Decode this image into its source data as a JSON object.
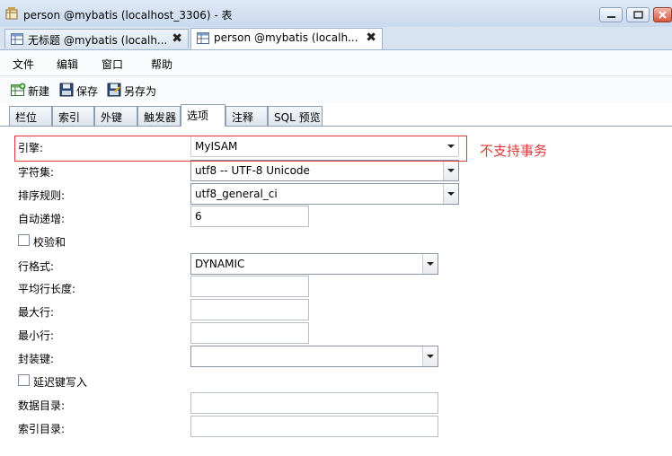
{
  "window": {
    "title": "person @mybatis (localhost_3306) - 表",
    "icon": "table-design-icon"
  },
  "doc_tabs": [
    {
      "label": "无标题 @mybatis (localh...",
      "icon": "table-icon",
      "close": "✖"
    },
    {
      "label": "person @mybatis (localh...",
      "icon": "table-icon",
      "close": "✖"
    }
  ],
  "menu": [
    "文件",
    "编辑",
    "窗口",
    "帮助"
  ],
  "toolbar": {
    "new": "新建",
    "save": "保存",
    "save_as": "另存为"
  },
  "prop_tabs": [
    "栏位",
    "索引",
    "外键",
    "触发器",
    "选项",
    "注释",
    "SQL 预览"
  ],
  "active_prop_tab": "选项",
  "form": {
    "engine": {
      "label": "引擎:",
      "value": "MyISAM"
    },
    "charset": {
      "label": "字符集:",
      "value": "utf8 -- UTF-8 Unicode"
    },
    "collation": {
      "label": "排序规则:",
      "value": "utf8_general_ci"
    },
    "auto_increment": {
      "label": "自动递增:",
      "value": "6"
    },
    "checksum": {
      "label": "校验和",
      "checked": false
    },
    "row_format": {
      "label": "行格式:",
      "value": "DYNAMIC"
    },
    "avg_row_length": {
      "label": "平均行长度:",
      "value": ""
    },
    "max_rows": {
      "label": "最大行:",
      "value": ""
    },
    "min_rows": {
      "label": "最小行:",
      "value": ""
    },
    "pack_keys": {
      "label": "封装键:",
      "value": ""
    },
    "delay_key_write": {
      "label": "延迟键写入",
      "checked": false
    },
    "data_directory": {
      "label": "数据目录:",
      "value": ""
    },
    "index_directory": {
      "label": "索引目录:",
      "value": ""
    }
  },
  "annotation": "不支持事务",
  "colors": {
    "annotation": "#e0383b",
    "titlebar": "#c9d9ee"
  }
}
